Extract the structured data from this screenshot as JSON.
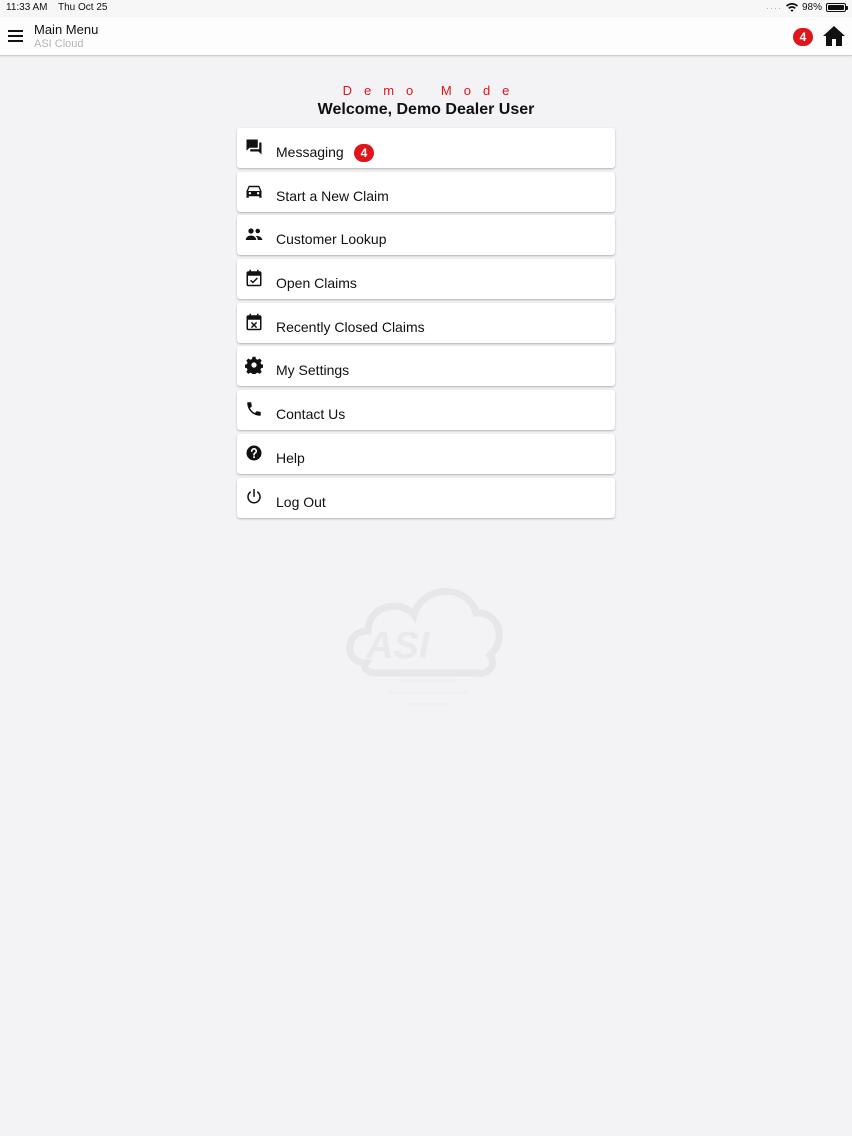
{
  "status_bar": {
    "time": "11:33 AM",
    "date": "Thu Oct 25",
    "battery": "98%",
    "battery_level": 0.98
  },
  "nav": {
    "title": "Main Menu",
    "subtitle": "ASI Cloud",
    "badge_count": "4",
    "menu_icon": "hamburger-icon",
    "home_icon": "home-icon"
  },
  "header": {
    "demo_mode": "Demo Mode",
    "welcome": "Welcome, Demo Dealer User"
  },
  "menu": {
    "items": [
      {
        "label": "Messaging",
        "icon": "chat-bubbles-icon",
        "badge": "4"
      },
      {
        "label": "Start a New Claim",
        "icon": "car-icon"
      },
      {
        "label": "Customer Lookup",
        "icon": "people-icon"
      },
      {
        "label": "Open Claims",
        "icon": "calendar-check-icon"
      },
      {
        "label": "Recently Closed Claims",
        "icon": "calendar-x-icon"
      },
      {
        "label": "My Settings",
        "icon": "gear-icon"
      },
      {
        "label": "Contact Us",
        "icon": "phone-icon"
      },
      {
        "label": "Help",
        "icon": "help-circle-icon"
      },
      {
        "label": "Log Out",
        "icon": "power-icon"
      }
    ]
  },
  "watermark": {
    "logo_text": "ASI"
  },
  "colors": {
    "accent_red": "#e0151b",
    "background": "#f3f2f4",
    "card": "#ffffff"
  }
}
